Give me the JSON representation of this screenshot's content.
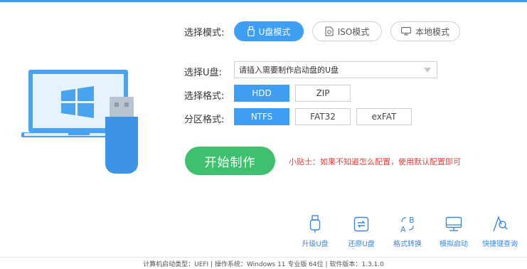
{
  "mode": {
    "label": "选择模式:",
    "options": [
      {
        "label": "U盘模式",
        "icon": "usb-drive-icon",
        "active": true
      },
      {
        "label": "ISO模式",
        "icon": "iso-file-icon",
        "active": false
      },
      {
        "label": "本地模式",
        "icon": "monitor-icon",
        "active": false
      }
    ]
  },
  "usb": {
    "label": "选择U盘:",
    "selected": "请插入需要制作启动盘的U盘"
  },
  "format": {
    "label": "选择格式:",
    "options": [
      {
        "label": "HDD",
        "active": true
      },
      {
        "label": "ZIP",
        "active": false
      }
    ]
  },
  "partition": {
    "label": "分区格式:",
    "options": [
      {
        "label": "NTFS",
        "active": true
      },
      {
        "label": "FAT32",
        "active": false
      },
      {
        "label": "exFAT",
        "active": false
      }
    ]
  },
  "start_button": "开始制作",
  "tip": "小贴士：如果不知道怎么配置，使用默认配置即可",
  "tools": [
    {
      "label": "升级U盘",
      "icon": "usb-upgrade-icon"
    },
    {
      "label": "还原U盘",
      "icon": "restore-icon"
    },
    {
      "label": "格式转换",
      "icon": "format-convert-icon"
    },
    {
      "label": "模拟启动",
      "icon": "monitor-icon"
    },
    {
      "label": "快捷键查询",
      "icon": "shortcut-query-icon"
    }
  ],
  "status_bar": "计算机启动类型：UEFI | 操作系统：Windows 11 专业版 64位 | 软件版本：1.3.1.0",
  "colors": {
    "accent": "#3e9ef2",
    "start": "#3ec06f",
    "tip": "#e8413c",
    "tool_label": "#3a88d8"
  }
}
